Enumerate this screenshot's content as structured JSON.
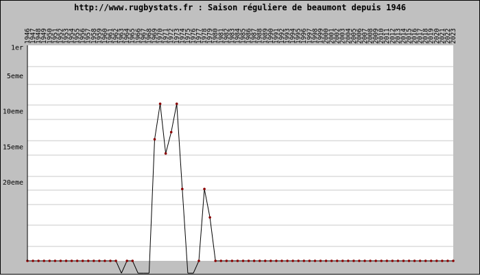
{
  "chart_data": {
    "type": "line",
    "title": "http://www.rugbystats.fr : Saison réguliere de beaumont depuis 1946",
    "xlabel": "",
    "ylabel": "",
    "y_axis": "rank, 1 at top, inverted",
    "ylim": [
      1,
      27
    ],
    "y_tick_labels": [
      {
        "rank": 1,
        "label": "1er"
      },
      {
        "rank": 5,
        "label": "5eme"
      },
      {
        "rank": 10,
        "label": "10eme"
      },
      {
        "rank": 15,
        "label": "15eme"
      },
      {
        "rank": 20,
        "label": "20eme"
      }
    ],
    "x_labels_position": "top, vertical",
    "grid": true,
    "legend": "none",
    "colors": {
      "frame": "#c0c0c0",
      "plot_background": "#ffffff",
      "line": "#000000",
      "marker": "#8b0000",
      "baseline_band": "#c0c0c0",
      "grid": "#c8c8c8"
    },
    "x": [
      1946,
      1947,
      1948,
      1949,
      1950,
      1951,
      1952,
      1953,
      1954,
      1955,
      1956,
      1957,
      1958,
      1959,
      1960,
      1961,
      1962,
      1963,
      1964,
      1965,
      1966,
      1967,
      1968,
      1969,
      1970,
      1971,
      1972,
      1973,
      1974,
      1975,
      1976,
      1977,
      1978,
      1979,
      1980,
      1981,
      1982,
      1983,
      1984,
      1985,
      1986,
      1987,
      1988,
      1989,
      1990,
      1991,
      1992,
      1993,
      1994,
      1995,
      1996,
      1997,
      1998,
      1999,
      2000,
      2001,
      2002,
      2003,
      2004,
      2005,
      2006,
      2007,
      2008,
      2009,
      2010,
      2011,
      2012,
      2013,
      2014,
      2015,
      2016,
      2017,
      2018,
      2019,
      2020,
      2021,
      2022,
      2023
    ],
    "series": [
      {
        "values": [
          0,
          0,
          0,
          0,
          0,
          0,
          0,
          0,
          0,
          0,
          0,
          0,
          0,
          0,
          0,
          0,
          0,
          null,
          0,
          0,
          null,
          null,
          null,
          14,
          9,
          16,
          13,
          9,
          21,
          null,
          null,
          0,
          21,
          25,
          0,
          0,
          0,
          0,
          0,
          0,
          0,
          0,
          0,
          0,
          0,
          0,
          0,
          0,
          0,
          0,
          0,
          0,
          0,
          0,
          0,
          0,
          0,
          0,
          0,
          0,
          0,
          0,
          0,
          0,
          0,
          0,
          0,
          0,
          0,
          0,
          0,
          0,
          0,
          0,
          0,
          0,
          0,
          0
        ]
      }
    ]
  }
}
